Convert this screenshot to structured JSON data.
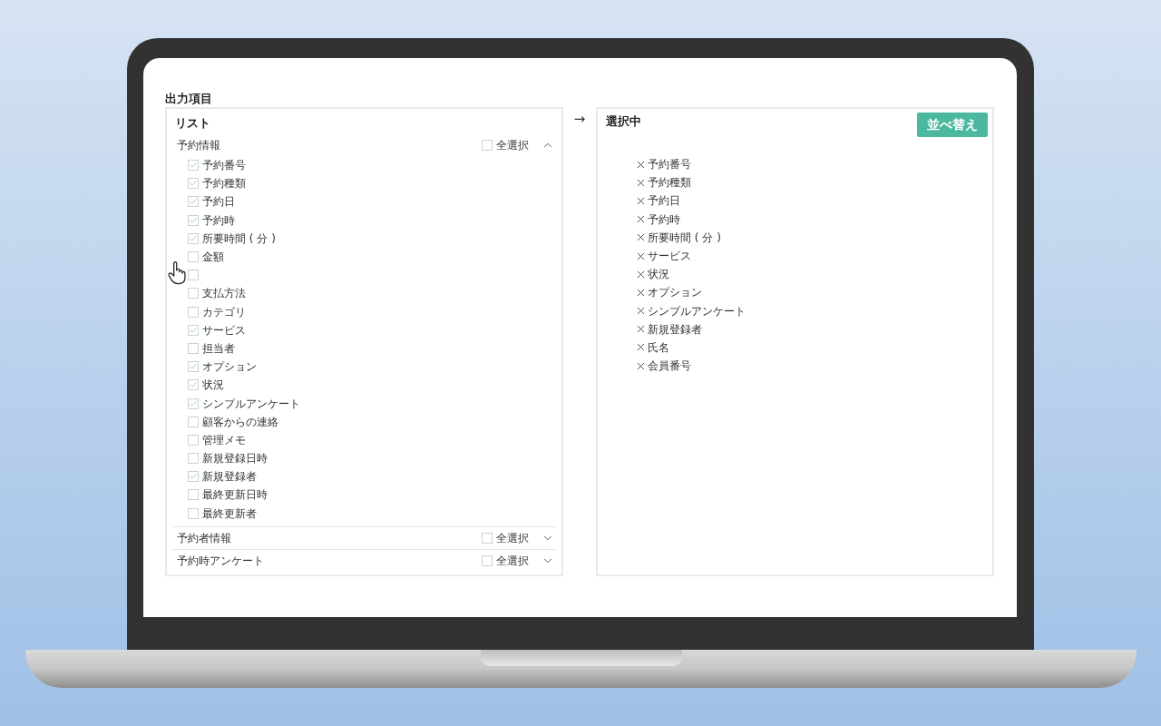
{
  "section_title": "出力項目",
  "list_panel": {
    "title": "リスト",
    "groups": [
      {
        "label": "予約情報",
        "select_all": {
          "label": "全選択",
          "checked": false
        },
        "expanded": true,
        "items": [
          {
            "label": "予約番号",
            "checked": true
          },
          {
            "label": "予約種類",
            "checked": true
          },
          {
            "label": "予約日",
            "checked": true
          },
          {
            "label": "予約時",
            "checked": true
          },
          {
            "label": "所要時間 ( 分 )",
            "checked": true
          },
          {
            "label": "金額",
            "checked": false
          },
          {
            "checked": false
          },
          {
            "label": "支払方法",
            "checked": false
          },
          {
            "label": "カテゴリ",
            "checked": false
          },
          {
            "label": "サービス",
            "checked": true
          },
          {
            "label": "担当者",
            "checked": false
          },
          {
            "label": "オプション",
            "checked": true
          },
          {
            "label": "状況",
            "checked": true
          },
          {
            "label": "シンプルアンケート",
            "checked": true
          },
          {
            "label": "顧客からの連絡",
            "checked": false
          },
          {
            "label": "管理メモ",
            "checked": false
          },
          {
            "label": "新規登録日時",
            "checked": false
          },
          {
            "label": "新規登録者",
            "checked": true
          },
          {
            "label": "最終更新日時",
            "checked": false
          },
          {
            "label": "最終更新者",
            "checked": false
          }
        ]
      },
      {
        "label": "予約者情報",
        "select_all": {
          "label": "全選択",
          "checked": false
        },
        "expanded": false
      },
      {
        "label": "予約時アンケート",
        "select_all": {
          "label": "全選択",
          "checked": false
        },
        "expanded": false
      }
    ]
  },
  "arrow": "→",
  "selected_panel": {
    "title": "選択中",
    "sort_button": "並べ替え",
    "items": [
      "予約番号",
      "予約種類",
      "予約日",
      "予約時",
      "所要時間 ( 分 )",
      "サービス",
      "状況",
      "オプション",
      "シンプルアンケート",
      "新規登録者",
      "氏名",
      "会員番号"
    ]
  }
}
